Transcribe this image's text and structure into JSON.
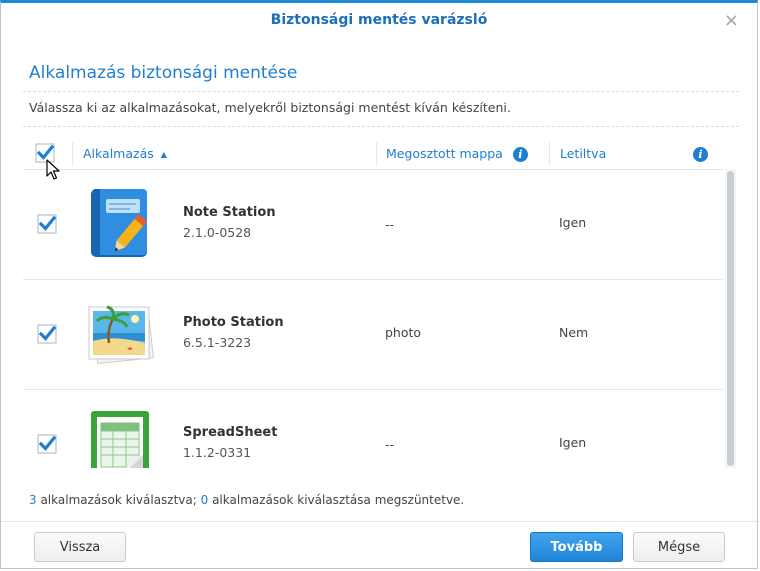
{
  "dialog": {
    "title": "Biztonsági mentés varázsló",
    "close_glyph": "×",
    "subtitle": "Alkalmazás biztonsági mentése",
    "description": "Válassza ki az alkalmazásokat, melyekről biztonsági mentést kíván készíteni."
  },
  "table": {
    "columns": {
      "app": "Alkalmazás",
      "sort_glyph": "▲",
      "shared_folder": "Megosztott mappa",
      "disabled": "Letiltva",
      "info_glyph": "i"
    },
    "rows": [
      {
        "name": "Note Station",
        "version": "2.1.0-0528",
        "folder": "--",
        "disabled": "Igen",
        "checked": true,
        "icon": "note-station-icon"
      },
      {
        "name": "Photo Station",
        "version": "6.5.1-3223",
        "folder": "photo",
        "disabled": "Nem",
        "checked": true,
        "icon": "photo-station-icon"
      },
      {
        "name": "SpreadSheet",
        "version": "1.1.2-0331",
        "folder": "--",
        "disabled": "Igen",
        "checked": true,
        "icon": "spreadsheet-icon"
      }
    ]
  },
  "status": {
    "selected_count": "3",
    "selected_text": " alkalmazások kiválasztva; ",
    "deselected_count": "0",
    "deselected_text": " alkalmazások kiválasztása megszüntetve."
  },
  "buttons": {
    "back": "Vissza",
    "next": "Tovább",
    "cancel": "Mégse"
  },
  "colors": {
    "accent": "#1e7fd0",
    "title_border": "#1e8ad6"
  }
}
